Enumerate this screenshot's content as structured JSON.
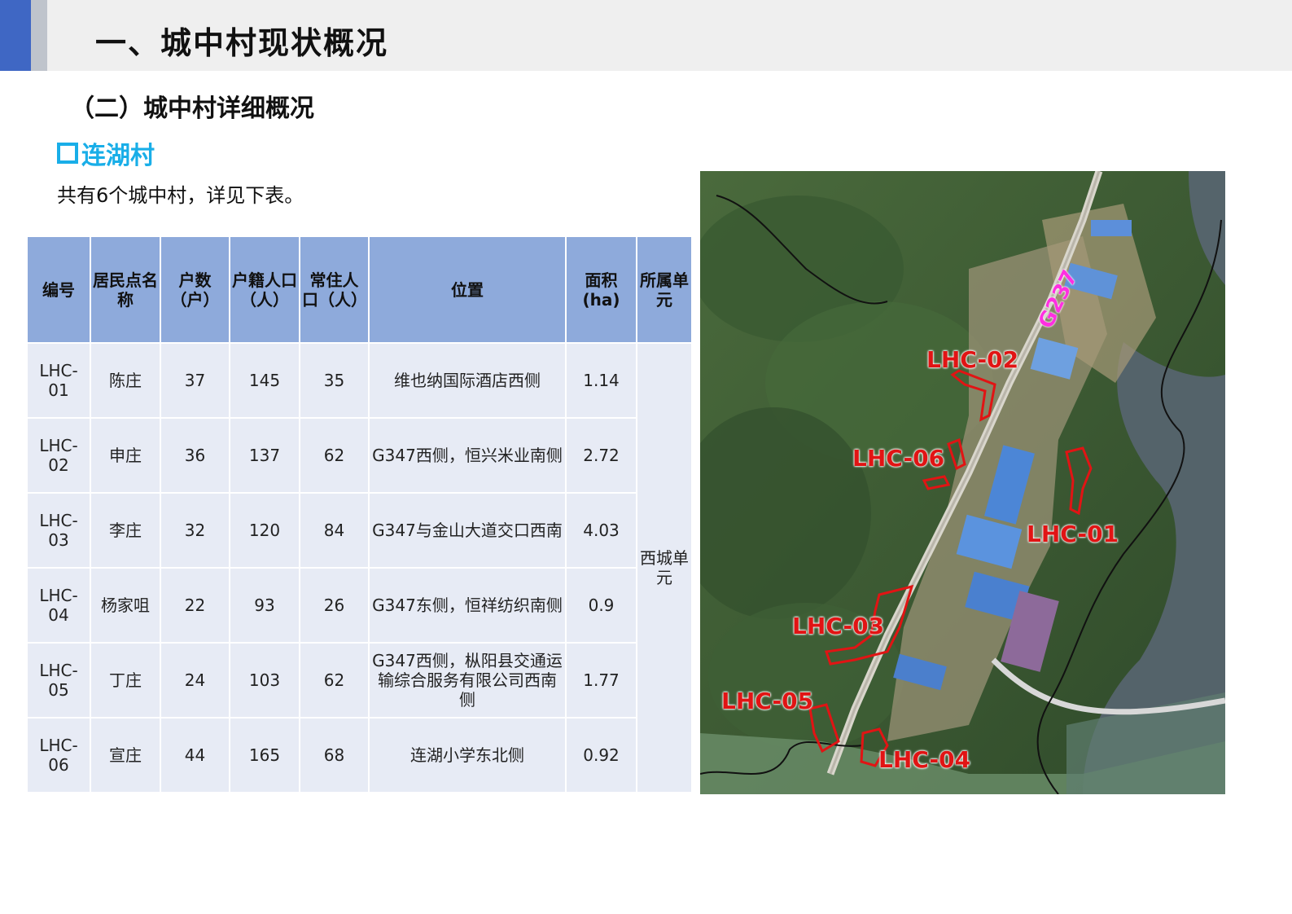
{
  "header": {
    "title": "一、城中村现状概况"
  },
  "section": {
    "title": "（二）城中村详细概况"
  },
  "subsection": {
    "title": "连湖村"
  },
  "intro": "共有6个城中村，详见下表。",
  "table": {
    "headers": [
      "编号",
      "居民点名称",
      "户数（户）",
      "户籍人口（人）",
      "常住人口（人）",
      "位置",
      "面积(ha)",
      "所属单元"
    ],
    "rows": [
      {
        "id": "LHC-01",
        "name": "陈庄",
        "households": "37",
        "registered": "145",
        "resident": "35",
        "location": "维也纳国际酒店西侧",
        "area": "1.14"
      },
      {
        "id": "LHC-02",
        "name": "申庄",
        "households": "36",
        "registered": "137",
        "resident": "62",
        "location": "G347西侧，恒兴米业南侧",
        "area": "2.72"
      },
      {
        "id": "LHC-03",
        "name": "李庄",
        "households": "32",
        "registered": "120",
        "resident": "84",
        "location": "G347与金山大道交口西南",
        "area": "4.03"
      },
      {
        "id": "LHC-04",
        "name": "杨家咀",
        "households": "22",
        "registered": "93",
        "resident": "26",
        "location": "G347东侧，恒祥纺织南侧",
        "area": "0.9"
      },
      {
        "id": "LHC-05",
        "name": "丁庄",
        "households": "24",
        "registered": "103",
        "resident": "62",
        "location": "G347西侧，枞阳县交通运输综合服务有限公司西南侧",
        "area": "1.77"
      },
      {
        "id": "LHC-06",
        "name": "宣庄",
        "households": "44",
        "registered": "165",
        "resident": "68",
        "location": "连湖小学东北侧",
        "area": "0.92"
      }
    ],
    "unit": "西城单元"
  },
  "map": {
    "road_label": "G237",
    "labels": [
      "LHC-01",
      "LHC-02",
      "LHC-03",
      "LHC-04",
      "LHC-05",
      "LHC-06"
    ]
  },
  "colors": {
    "accent": "#3f67c4",
    "subtitle": "#19aee8",
    "table_header": "#8eaadb",
    "table_cell": "#e7ebf5",
    "map_label": "#e11414",
    "road_label": "#ff2fe0"
  }
}
